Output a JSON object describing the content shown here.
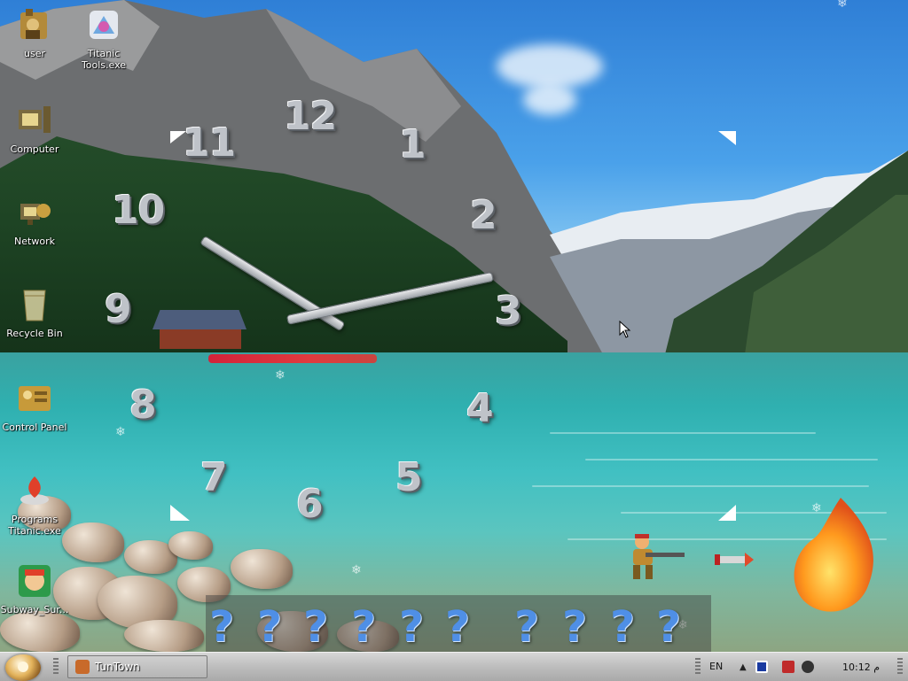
{
  "desktop": {
    "icons": [
      {
        "label": "user",
        "icon": "user-folder-icon"
      },
      {
        "label": "Titanic Tools.exe",
        "icon": "titanic-tools-icon"
      },
      {
        "label": "Computer",
        "icon": "computer-icon"
      },
      {
        "label": "Network",
        "icon": "network-icon"
      },
      {
        "label": "Recycle Bin",
        "icon": "recycle-bin-icon"
      },
      {
        "label": "Control Panel",
        "icon": "control-panel-icon"
      },
      {
        "label": "Programs Titanic.exe",
        "icon": "programs-titanic-icon"
      },
      {
        "label": "Subway_Sur...",
        "icon": "subway-surfers-icon"
      }
    ]
  },
  "clock": {
    "numerals": [
      "12",
      "1",
      "2",
      "3",
      "4",
      "5",
      "6",
      "7",
      "8",
      "9",
      "10",
      "11"
    ],
    "time": {
      "hour": 10,
      "minute": 12
    }
  },
  "question_bar": {
    "symbols": [
      "?",
      "?",
      "?",
      "?",
      "?",
      "?",
      "?",
      "?",
      "?",
      "?"
    ]
  },
  "taskbar": {
    "start_icon": "start-orb-icon",
    "tasks": [
      {
        "label": "TunTown",
        "icon": "tuntown-app-icon"
      }
    ],
    "tray": {
      "language": "EN",
      "show_hidden": "▲",
      "time": "10:12 م"
    }
  },
  "colors": {
    "sky": "#2f7fd6",
    "lake": "#2fb0b0",
    "taskbar": "#bdbdbd",
    "clock_numerals": "#bfc3c9",
    "question_marks": "#4f8fe6"
  }
}
